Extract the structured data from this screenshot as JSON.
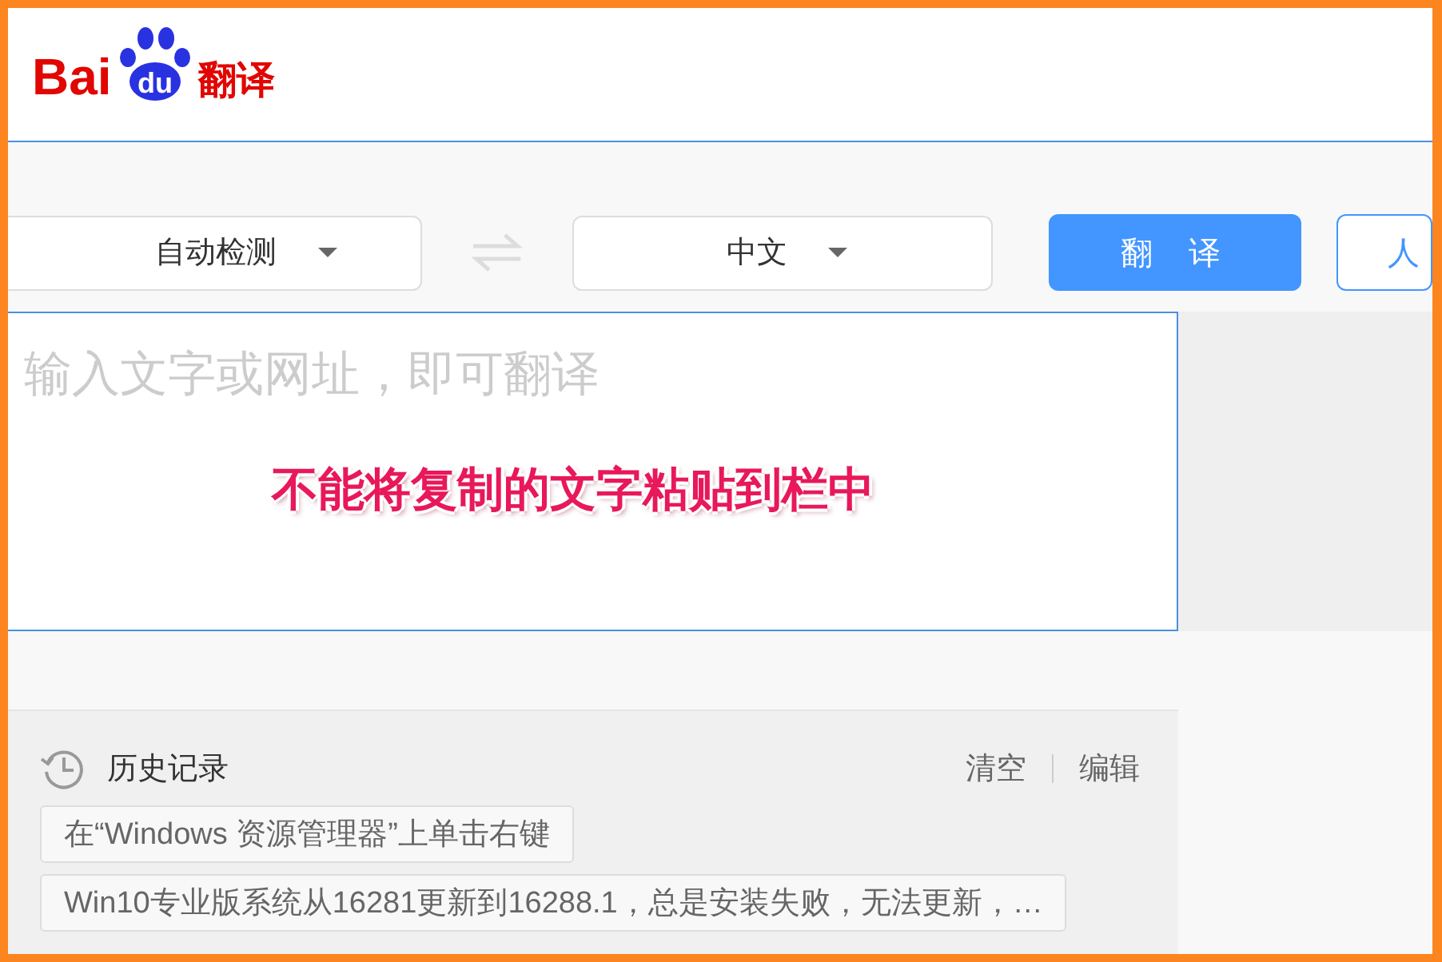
{
  "logo": {
    "brand_start": "Bai",
    "brand_mark": "du",
    "product": "翻译"
  },
  "source_language": {
    "label": "自动检测"
  },
  "target_language": {
    "label": "中文"
  },
  "translate_button": {
    "label": "翻 译"
  },
  "side_button": {
    "label": "人"
  },
  "input": {
    "placeholder": "输入文字或网址，即可翻译"
  },
  "annotation": "不能将复制的文字粘贴到栏中",
  "history": {
    "title": "历史记录",
    "actions": [
      "清空",
      "编辑"
    ],
    "items": [
      "在“Windows 资源管理器”上单击右键",
      "Win10专业版系统从16281更新到16288.1，总是安装失败，无法更新，…"
    ]
  }
}
